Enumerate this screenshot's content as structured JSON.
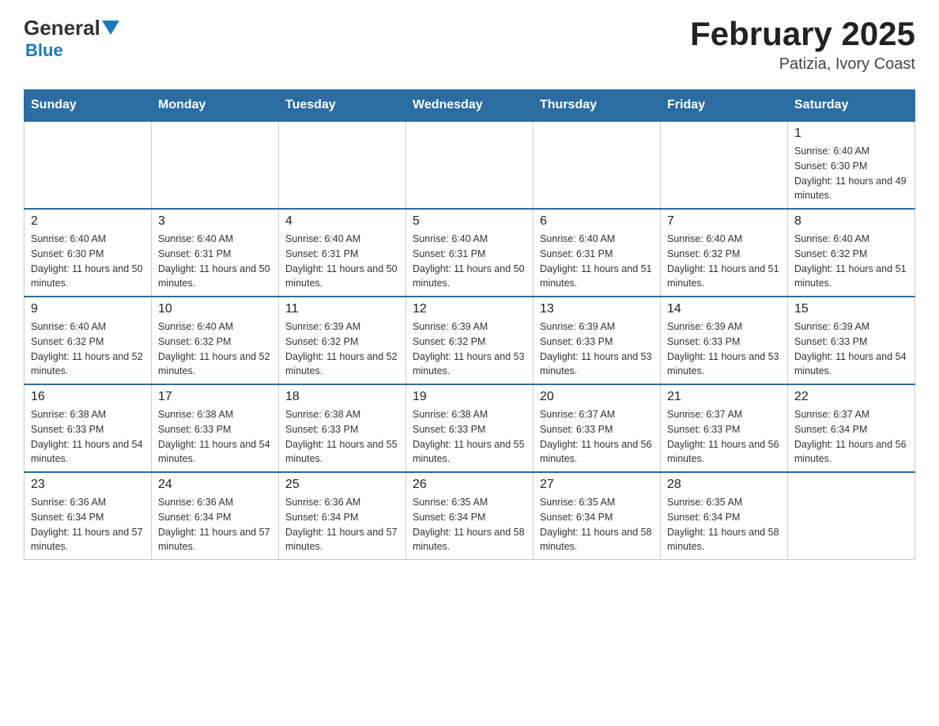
{
  "logo": {
    "general": "General",
    "blue": "Blue"
  },
  "title": "February 2025",
  "subtitle": "Patizia, Ivory Coast",
  "days_of_week": [
    "Sunday",
    "Monday",
    "Tuesday",
    "Wednesday",
    "Thursday",
    "Friday",
    "Saturday"
  ],
  "weeks": [
    [
      {
        "day": "",
        "info": ""
      },
      {
        "day": "",
        "info": ""
      },
      {
        "day": "",
        "info": ""
      },
      {
        "day": "",
        "info": ""
      },
      {
        "day": "",
        "info": ""
      },
      {
        "day": "",
        "info": ""
      },
      {
        "day": "1",
        "info": "Sunrise: 6:40 AM\nSunset: 6:30 PM\nDaylight: 11 hours and 49 minutes."
      }
    ],
    [
      {
        "day": "2",
        "info": "Sunrise: 6:40 AM\nSunset: 6:30 PM\nDaylight: 11 hours and 50 minutes."
      },
      {
        "day": "3",
        "info": "Sunrise: 6:40 AM\nSunset: 6:31 PM\nDaylight: 11 hours and 50 minutes."
      },
      {
        "day": "4",
        "info": "Sunrise: 6:40 AM\nSunset: 6:31 PM\nDaylight: 11 hours and 50 minutes."
      },
      {
        "day": "5",
        "info": "Sunrise: 6:40 AM\nSunset: 6:31 PM\nDaylight: 11 hours and 50 minutes."
      },
      {
        "day": "6",
        "info": "Sunrise: 6:40 AM\nSunset: 6:31 PM\nDaylight: 11 hours and 51 minutes."
      },
      {
        "day": "7",
        "info": "Sunrise: 6:40 AM\nSunset: 6:32 PM\nDaylight: 11 hours and 51 minutes."
      },
      {
        "day": "8",
        "info": "Sunrise: 6:40 AM\nSunset: 6:32 PM\nDaylight: 11 hours and 51 minutes."
      }
    ],
    [
      {
        "day": "9",
        "info": "Sunrise: 6:40 AM\nSunset: 6:32 PM\nDaylight: 11 hours and 52 minutes."
      },
      {
        "day": "10",
        "info": "Sunrise: 6:40 AM\nSunset: 6:32 PM\nDaylight: 11 hours and 52 minutes."
      },
      {
        "day": "11",
        "info": "Sunrise: 6:39 AM\nSunset: 6:32 PM\nDaylight: 11 hours and 52 minutes."
      },
      {
        "day": "12",
        "info": "Sunrise: 6:39 AM\nSunset: 6:32 PM\nDaylight: 11 hours and 53 minutes."
      },
      {
        "day": "13",
        "info": "Sunrise: 6:39 AM\nSunset: 6:33 PM\nDaylight: 11 hours and 53 minutes."
      },
      {
        "day": "14",
        "info": "Sunrise: 6:39 AM\nSunset: 6:33 PM\nDaylight: 11 hours and 53 minutes."
      },
      {
        "day": "15",
        "info": "Sunrise: 6:39 AM\nSunset: 6:33 PM\nDaylight: 11 hours and 54 minutes."
      }
    ],
    [
      {
        "day": "16",
        "info": "Sunrise: 6:38 AM\nSunset: 6:33 PM\nDaylight: 11 hours and 54 minutes."
      },
      {
        "day": "17",
        "info": "Sunrise: 6:38 AM\nSunset: 6:33 PM\nDaylight: 11 hours and 54 minutes."
      },
      {
        "day": "18",
        "info": "Sunrise: 6:38 AM\nSunset: 6:33 PM\nDaylight: 11 hours and 55 minutes."
      },
      {
        "day": "19",
        "info": "Sunrise: 6:38 AM\nSunset: 6:33 PM\nDaylight: 11 hours and 55 minutes."
      },
      {
        "day": "20",
        "info": "Sunrise: 6:37 AM\nSunset: 6:33 PM\nDaylight: 11 hours and 56 minutes."
      },
      {
        "day": "21",
        "info": "Sunrise: 6:37 AM\nSunset: 6:33 PM\nDaylight: 11 hours and 56 minutes."
      },
      {
        "day": "22",
        "info": "Sunrise: 6:37 AM\nSunset: 6:34 PM\nDaylight: 11 hours and 56 minutes."
      }
    ],
    [
      {
        "day": "23",
        "info": "Sunrise: 6:36 AM\nSunset: 6:34 PM\nDaylight: 11 hours and 57 minutes."
      },
      {
        "day": "24",
        "info": "Sunrise: 6:36 AM\nSunset: 6:34 PM\nDaylight: 11 hours and 57 minutes."
      },
      {
        "day": "25",
        "info": "Sunrise: 6:36 AM\nSunset: 6:34 PM\nDaylight: 11 hours and 57 minutes."
      },
      {
        "day": "26",
        "info": "Sunrise: 6:35 AM\nSunset: 6:34 PM\nDaylight: 11 hours and 58 minutes."
      },
      {
        "day": "27",
        "info": "Sunrise: 6:35 AM\nSunset: 6:34 PM\nDaylight: 11 hours and 58 minutes."
      },
      {
        "day": "28",
        "info": "Sunrise: 6:35 AM\nSunset: 6:34 PM\nDaylight: 11 hours and 58 minutes."
      },
      {
        "day": "",
        "info": ""
      }
    ]
  ]
}
